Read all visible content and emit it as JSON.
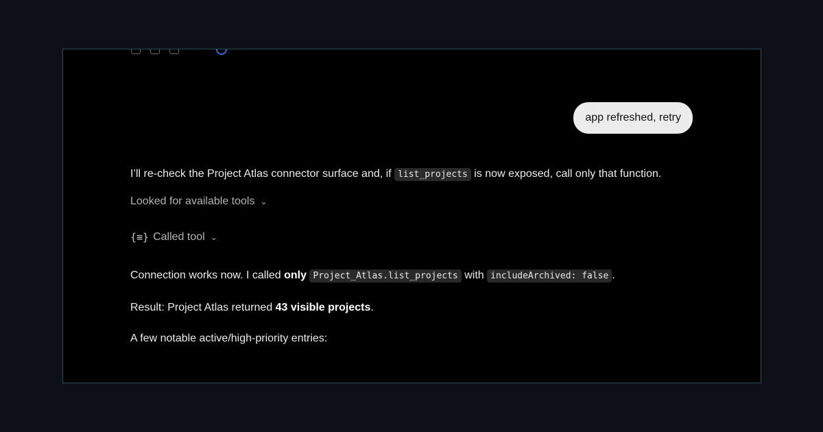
{
  "user_message": "app refreshed, retry",
  "assistant": {
    "intro": {
      "before": "I’ll re-check the Project Atlas connector surface and, if ",
      "code": "list_projects",
      "after": " is now exposed, call only that function."
    },
    "tool_rows": [
      {
        "icon": "",
        "label": "Looked for available tools"
      },
      {
        "icon": "{≡}",
        "label": "Called tool"
      }
    ],
    "connection": {
      "before": "Connection works now. I called ",
      "bold": "only",
      "code1": "Project_Atlas.list_projects",
      "middle": " with ",
      "code2": "includeArchived: false",
      "after": "."
    },
    "result": {
      "before": "Result: Project Atlas returned ",
      "bold": "43 visible projects",
      "after": "."
    },
    "notable": "A few notable active/high-priority entries:"
  },
  "colors": {
    "page_bg": "#0d1117",
    "frame_bg": "#000000",
    "frame_border": "#2b4f53",
    "bubble_bg": "#ececec",
    "code_bg": "#2a2a2a",
    "text": "#ececec",
    "muted": "#b4b4b4"
  }
}
